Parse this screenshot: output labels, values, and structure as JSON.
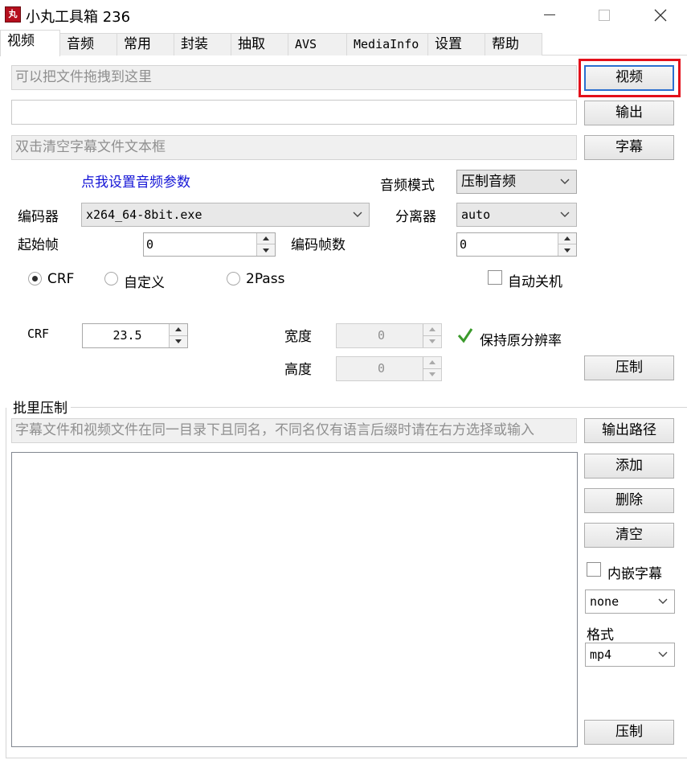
{
  "window": {
    "icon_text": "丸",
    "title": "小丸工具箱 236",
    "minimize_glyph": "—",
    "maximize_glyph": "☐",
    "close_glyph": "✕"
  },
  "tabs": [
    "视频",
    "音频",
    "常用",
    "封装",
    "抽取",
    "AVS",
    "MediaInfo",
    "设置",
    "帮助"
  ],
  "video": {
    "video_drop_placeholder": "可以把文件拖拽到这里",
    "output_value": "",
    "subtitle_placeholder": "双击清空字幕文件文本框",
    "video_button": "视频",
    "output_button": "输出",
    "subtitle_button": "字幕",
    "audio_settings_link": "点我设置音频参数",
    "audio_mode_label": "音频模式",
    "audio_mode_value": "压制音频",
    "encoder_label": "编码器",
    "encoder_value": "x264_64-8bit.exe",
    "splitter_label": "分离器",
    "splitter_value": "auto",
    "start_frame_label": "起始帧",
    "start_frame_value": "0",
    "encode_frames_label": "编码帧数",
    "encode_frames_value": "0",
    "mode_crf": "CRF",
    "mode_custom": "自定义",
    "mode_2pass": "2Pass",
    "selected_mode": "CRF",
    "auto_shutdown_label": "自动关机",
    "auto_shutdown_checked": false,
    "crf_label": "CRF",
    "crf_value": "23.5",
    "width_label": "宽度",
    "width_value": "0",
    "height_label": "高度",
    "height_value": "0",
    "keep_resolution_label": "保持原分辨率",
    "keep_resolution_checked": true,
    "encode_button": "压制"
  },
  "batch": {
    "group_title": "批里压制",
    "hint_placeholder": "字幕文件和视频文件在同一目录下且同名，不同名仅有语言后缀时请在右方选择或输入",
    "output_path_button": "输出路径",
    "add_button": "添加",
    "delete_button": "删除",
    "clear_button": "清空",
    "embed_subtitle_label": "内嵌字幕",
    "embed_subtitle_checked": false,
    "subtitle_lang_value": "none",
    "format_label": "格式",
    "format_value": "mp4",
    "encode_button": "压制",
    "files": []
  },
  "colors": {
    "highlight_frame": "#e3101a",
    "link_blue": "#1414d6",
    "check_green": "#3a9a2b"
  }
}
